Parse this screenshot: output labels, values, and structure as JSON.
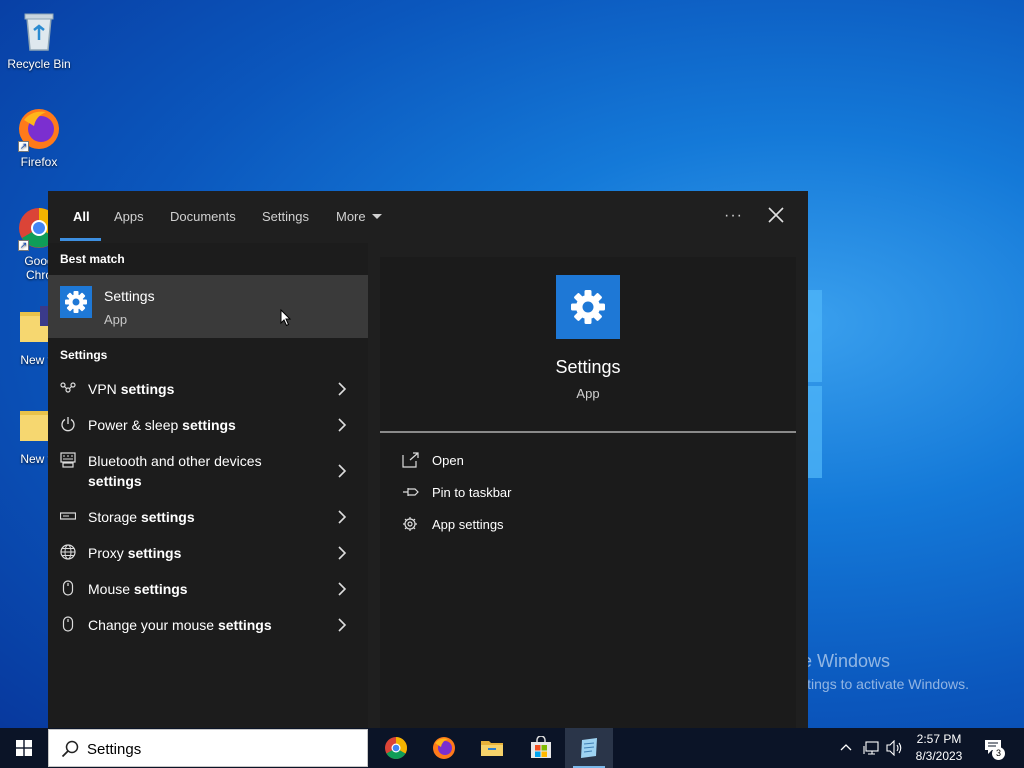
{
  "desktop": {
    "icons": [
      {
        "label": "Recycle Bin"
      },
      {
        "label": "Firefox"
      },
      {
        "label": "Goog\nChro"
      },
      {
        "label": "New fo"
      },
      {
        "label": "New fo"
      }
    ],
    "watermark": {
      "title": "Activate Windows",
      "subtitle": "Go to Settings to activate Windows."
    }
  },
  "search_panel": {
    "tabs": [
      {
        "label": "All",
        "active": true
      },
      {
        "label": "Apps"
      },
      {
        "label": "Documents"
      },
      {
        "label": "Settings"
      },
      {
        "label": "More"
      }
    ],
    "more_options_label": "···",
    "best_match": {
      "heading": "Best match",
      "name": "Settings",
      "type": "App",
      "icon": "gear-icon"
    },
    "settings_section": {
      "heading": "Settings",
      "items": [
        {
          "pre": "VPN ",
          "bold": "settings",
          "icon": "vpn-icon"
        },
        {
          "pre": "Power & sleep ",
          "bold": "settings",
          "icon": "power-icon"
        },
        {
          "pre": "Bluetooth and other devices ",
          "bold": "settings",
          "icon": "devices-icon"
        },
        {
          "pre": "Storage ",
          "bold": "settings",
          "icon": "storage-icon"
        },
        {
          "pre": "Proxy ",
          "bold": "settings",
          "icon": "globe-icon"
        },
        {
          "pre": "Mouse ",
          "bold": "settings",
          "icon": "mouse-icon"
        },
        {
          "pre": "Change your mouse ",
          "bold": "settings",
          "icon": "mouse-icon"
        }
      ]
    },
    "preview": {
      "name": "Settings",
      "type": "App",
      "actions": [
        {
          "label": "Open",
          "icon": "open-icon"
        },
        {
          "label": "Pin to taskbar",
          "icon": "pin-icon"
        },
        {
          "label": "App settings",
          "icon": "gear-icon"
        }
      ]
    }
  },
  "taskbar": {
    "search_value": "Settings",
    "apps": [
      "chrome-icon",
      "firefox-icon",
      "file-explorer-icon",
      "store-icon",
      "notepad-icon"
    ],
    "clock": {
      "time": "2:57 PM",
      "date": "8/3/2023"
    },
    "notification_count": "3"
  },
  "colors": {
    "accent": "#1e78d6",
    "panel": "#1f1f1f",
    "highlight": "#3a3a3a",
    "taskbar": "#0b1427"
  }
}
